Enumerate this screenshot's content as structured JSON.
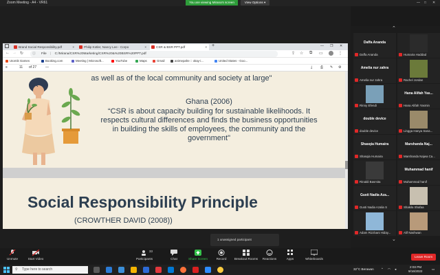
{
  "zoom": {
    "window_title": "Zoom Meeting - A4 - VR61",
    "viewing_banner": "You are viewing Mirana's screen",
    "view_options": "View Options ▾"
  },
  "browser": {
    "tabs": [
      {
        "label": "Brand Social Responsibility.pdf"
      },
      {
        "label": "Philip Kotler, Nancy Lee - Corpo"
      },
      {
        "label": "CSR & BSR PPT.pdf"
      }
    ],
    "new_tab": "+",
    "url_prefix": "File",
    "url": "C:/Mirana/CSR%20Marketing/CSR%20&%20BSR%20PPT.pdf",
    "bookmarks": [
      {
        "label": "Utomik Games",
        "color": "#e64a19"
      },
      {
        "label": "Booking.com",
        "color": "#1a3f8f"
      },
      {
        "label": "Meeting | Microsoft...",
        "color": "#5b5fc7"
      },
      {
        "label": "YouTube",
        "color": "#ff0000"
      },
      {
        "label": "Maps",
        "color": "#34a853"
      },
      {
        "label": "Gmail",
        "color": "#ea4335"
      },
      {
        "label": "animepahe :: okay-i...",
        "color": "#444444"
      },
      {
        "label": "United States - Goo...",
        "color": "#4285f4"
      }
    ],
    "pdf": {
      "page_current": "11",
      "page_total": "of 27",
      "zoom_minus": "—"
    }
  },
  "slide1": {
    "line1": "as well as of  the  local community  and society at large\"",
    "cite": "Ghana (2006)",
    "quote": [
      "“CSR is about capacity building for sustainable likelihoods. It",
      "respects cultural differences and finds the business opportunities",
      "in building the skills of employees, the community and the",
      "government\""
    ]
  },
  "slide2": {
    "title": "Social Responsibility Principle",
    "subtitle": "(CROWTHER DAVID (2008))"
  },
  "participants": [
    {
      "name": "Daffa Ananda",
      "sub": "Daffa Ananda",
      "photo": false
    },
    {
      "name": "",
      "sub": "Humaira Haddad",
      "photo": true,
      "photo_color": "#2b2b2b"
    },
    {
      "name": "Amelia nur zahra",
      "sub": "Amelia nur zahra",
      "photo": false
    },
    {
      "name": "",
      "sub": "Rachel Jordan",
      "photo": true,
      "photo_color": "#6b7a3a"
    },
    {
      "name": "",
      "sub": "Rinny Efendi",
      "photo": true,
      "photo_color": "#7aa0b8"
    },
    {
      "name": "Hana Alifah Yas...",
      "sub": "Hana Alifah Yasmin",
      "photo": false
    },
    {
      "name": "double device",
      "sub": "double device",
      "photo": false
    },
    {
      "name": "",
      "sub": "Lingga Hanya Sana...",
      "photo": true,
      "photo_color": "#9a8a6a"
    },
    {
      "name": "Shasqia Humaira",
      "sub": "Shasqia Humaira",
      "photo": false
    },
    {
      "name": "Marshanda  Naj...",
      "sub": "Marshanda Najwa Ca...",
      "photo": false
    },
    {
      "name": "",
      "sub": "Rinaldi Basmita",
      "photo": true,
      "photo_color": "#3a3a3a"
    },
    {
      "name": "Muhammad hanif",
      "sub": "Muhammad hanif",
      "photo": false
    },
    {
      "name": "Gusti Nadia Aza...",
      "sub": "Gusti Nadia Azalia S",
      "photo": false
    },
    {
      "name": "",
      "sub": "Shakila Shafaa",
      "photo": true,
      "photo_color": "#c8c0b0"
    },
    {
      "name": "",
      "sub": "Adam Rizzbani Hiday...",
      "photo": true,
      "photo_color": "#8fb7d8"
    },
    {
      "name": "",
      "sub": "Alif Nashwan",
      "photo": true,
      "photo_color": "#b89a7a"
    }
  ],
  "toolbar": {
    "unmute": "Unmute",
    "start_video": "Start Video",
    "participants": "Participants",
    "participants_count": "33",
    "chat": "Chat",
    "share_screen": "Share Screen",
    "record": "Record",
    "breakout_rooms": "Breakout Rooms",
    "reactions": "Reactions",
    "apps": "Apps",
    "whiteboards": "Whiteboards",
    "leave": "Leave Room",
    "unassigned": "1 unassigned participant"
  },
  "taskbar": {
    "search_placeholder": "Type here to search",
    "weather": "32°C  Berawan",
    "time": "2:03 PM",
    "date": "9/16/2022"
  }
}
